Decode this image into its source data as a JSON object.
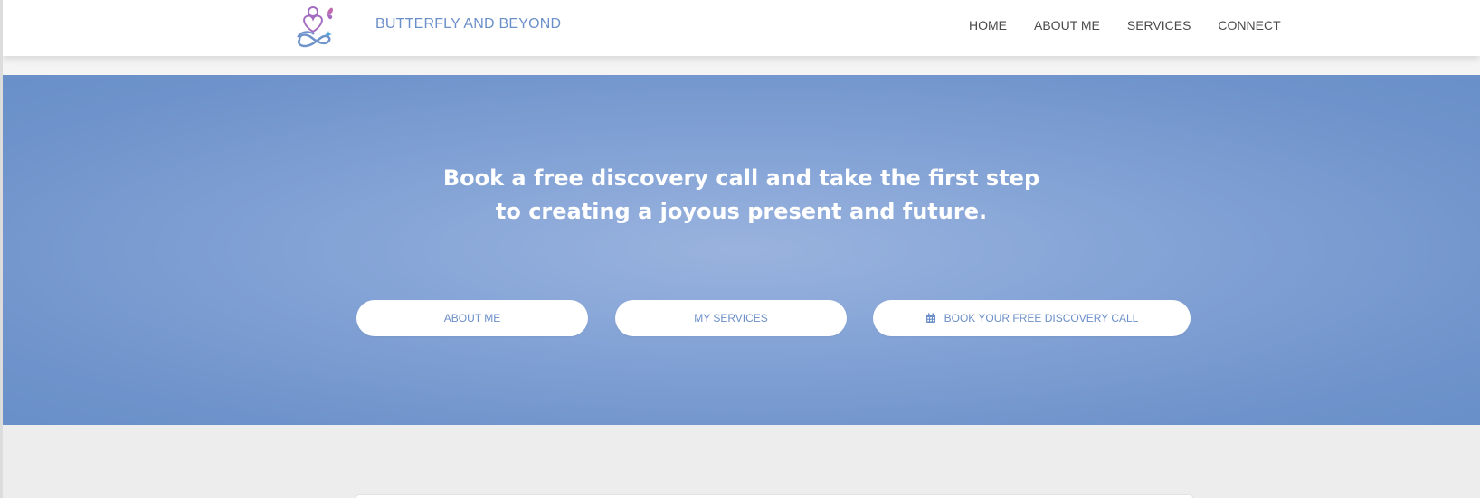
{
  "header": {
    "brand": "BUTTERFLY AND BEYOND",
    "logo_icon": "butterfly-heart-infinity-logo",
    "nav": [
      {
        "label": "HOME"
      },
      {
        "label": "ABOUT ME"
      },
      {
        "label": "SERVICES"
      },
      {
        "label": "CONNECT"
      }
    ]
  },
  "hero": {
    "title_line1": "Book a free discovery call and take the first step",
    "title_line2": "to creating a joyous present and future.",
    "buttons": {
      "about": "ABOUT ME",
      "services": "MY SERVICES",
      "book": "BOOK YOUR FREE DISCOVERY CALL",
      "book_icon": "calendar-icon"
    }
  },
  "colors": {
    "brand": "#6b8fc8",
    "hero_bg": "#7b9dd1",
    "lower_bg": "#ededed",
    "logo_purple": "#a36cc0",
    "logo_blue": "#6f93cb"
  }
}
